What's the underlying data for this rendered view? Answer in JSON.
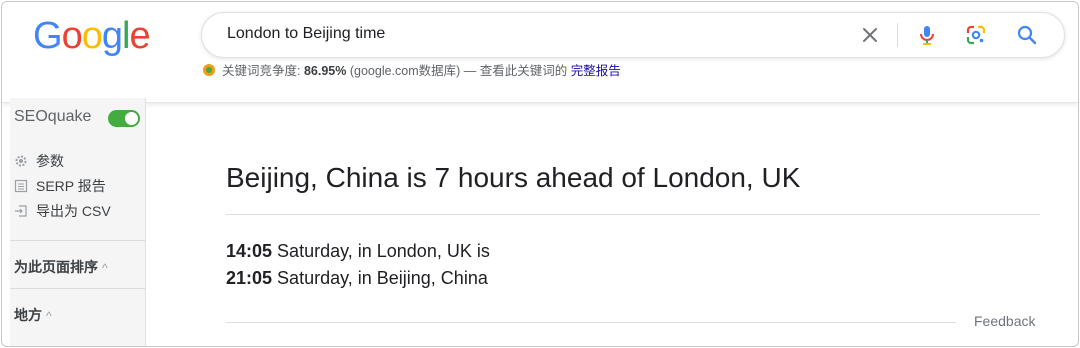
{
  "logo": {
    "letters": [
      "G",
      "o",
      "o",
      "g",
      "l",
      "e"
    ],
    "colors": [
      "#4285F4",
      "#EA4335",
      "#FBBC05",
      "#4285F4",
      "#34A853",
      "#EA4335"
    ]
  },
  "search": {
    "query": "London to Beijing time",
    "icons": [
      "close-icon",
      "microphone-icon",
      "google-lens-icon",
      "search-icon"
    ]
  },
  "seo_bar": {
    "label": "关键词竞争度:",
    "value": "86.95%",
    "source": "(google.com数据库) — 查看此关键词的",
    "link": "完整报告"
  },
  "sidebar": {
    "title": "SEOquake",
    "toggle_on": true,
    "accent": "#44ab3f",
    "items": [
      {
        "label": "参数",
        "icon": "gear-icon"
      },
      {
        "label": "SERP 报告",
        "icon": "report-icon"
      },
      {
        "label": "导出为 CSV",
        "icon": "export-icon"
      }
    ],
    "sections": [
      {
        "label": "为此页面排序",
        "chevron": "^"
      },
      {
        "label": "地方",
        "chevron": "^"
      }
    ]
  },
  "answer": {
    "title": "Beijing, China is 7 hours ahead of London, UK",
    "lines": [
      {
        "time": "14:05",
        "text": " Saturday, in London, UK is"
      },
      {
        "time": "21:05",
        "text": " Saturday, in Beijing, China"
      }
    ],
    "feedback": "Feedback"
  }
}
